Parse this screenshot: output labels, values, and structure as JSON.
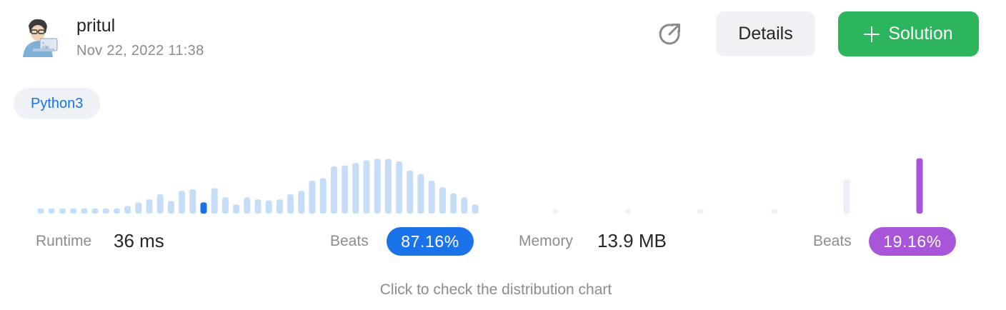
{
  "header": {
    "username": "pritul",
    "timestamp": "Nov 22, 2022 11:38",
    "avatar_icon": "user-avatar-icon",
    "share_icon": "external-link-icon",
    "details_label": "Details",
    "solution_label": "Solution"
  },
  "language": "Python3",
  "stats": {
    "runtime_label": "Runtime",
    "runtime_value": "36 ms",
    "runtime_beats_label": "Beats",
    "runtime_beats": "87.16%",
    "memory_label": "Memory",
    "memory_value": "13.9 MB",
    "memory_beats_label": "Beats",
    "memory_beats": "19.16%"
  },
  "hint": "Click to check the distribution chart",
  "colors": {
    "accent_blue": "#1a73e8",
    "accent_purple": "#a855d9",
    "solution_green": "#2cb55d",
    "runtime_bar": "#c6ddf8",
    "memory_bar": "#eaf0f9"
  },
  "chart_data": [
    {
      "type": "bar",
      "name": "runtime-distribution",
      "values": [
        1,
        1,
        1,
        1,
        1,
        1,
        1,
        1,
        1.5,
        2.2,
        2.8,
        3.8,
        2.5,
        4.5,
        4.8,
        2.2,
        5.0,
        3.2,
        1.8,
        3.2,
        2.8,
        2.6,
        2.8,
        3.8,
        4.5,
        6.5,
        7.0,
        9.3,
        9.5,
        10.0,
        10.5,
        10.8,
        10.8,
        10.3,
        8.5,
        7.8,
        6.5,
        5.2,
        4.0,
        3.2,
        1.8
      ],
      "highlight_index": 15,
      "ylim": [
        0,
        11
      ]
    },
    {
      "type": "bar",
      "name": "memory-distribution",
      "values": [
        1,
        1,
        1,
        1,
        9,
        14.5
      ],
      "highlight_index": 5,
      "ylim": [
        0,
        15
      ]
    }
  ]
}
